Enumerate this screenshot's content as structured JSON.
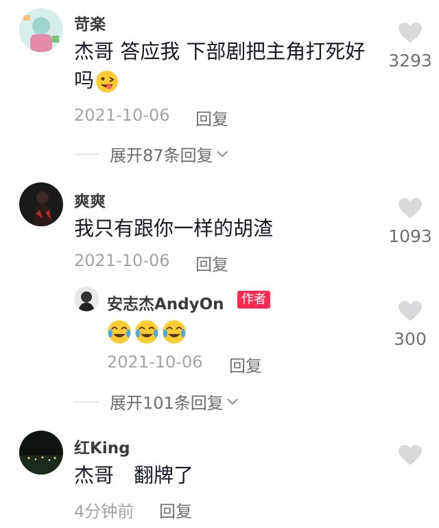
{
  "comments": [
    {
      "username": "苛楽",
      "text": "杰哥 答应我 下部剧把主角打死好吗",
      "date": "2021-10-06",
      "reply_label": "回复",
      "likes": "3293",
      "expand_label": "展开87条回复"
    },
    {
      "username": "爽爽",
      "text": "我只有跟你一样的胡渣",
      "date": "2021-10-06",
      "reply_label": "回复",
      "likes": "1093",
      "sub_reply": {
        "username": "安志杰AndyOn",
        "badge": "作者",
        "date": "2021-10-06",
        "reply_label": "回复",
        "likes": "300"
      },
      "expand_label": "展开101条回复"
    },
    {
      "username": "红King",
      "text": "杰哥　翻牌了",
      "date": "4分钟前",
      "reply_label": "回复"
    }
  ],
  "colors": {
    "badge": "#fe2c55",
    "heart": "#d9d9dc"
  }
}
